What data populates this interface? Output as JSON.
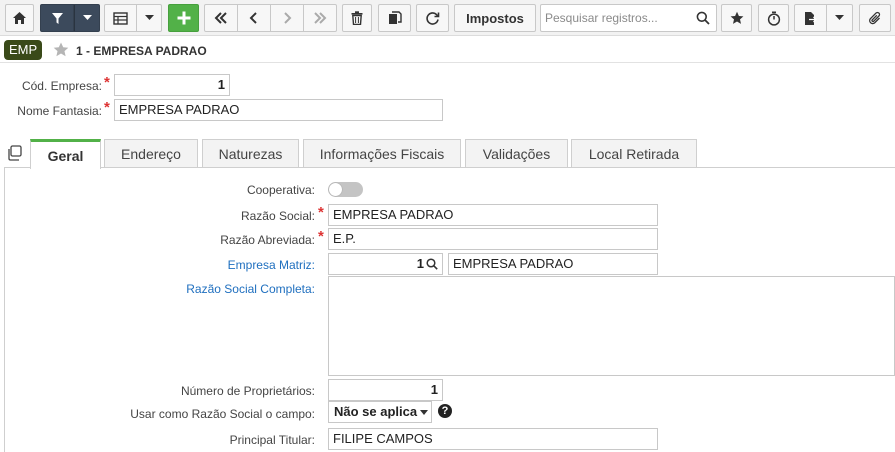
{
  "toolbar": {
    "impostos_label": "Impostos",
    "search_placeholder": "Pesquisar registros..."
  },
  "header": {
    "badge": "EMP",
    "record_title": "1 - EMPRESA PADRAO"
  },
  "top_form": {
    "cod_empresa_label": "Cód. Empresa:",
    "cod_empresa_value": "1",
    "nome_fantasia_label": "Nome Fantasia:",
    "nome_fantasia_value": "EMPRESA PADRAO"
  },
  "tabs": [
    {
      "label": "Geral"
    },
    {
      "label": "Endereço"
    },
    {
      "label": "Naturezas"
    },
    {
      "label": "Informações Fiscais"
    },
    {
      "label": "Validações"
    },
    {
      "label": "Local Retirada"
    }
  ],
  "geral": {
    "cooperativa_label": "Cooperativa:",
    "razao_social_label": "Razão Social:",
    "razao_social_value": "EMPRESA PADRAO",
    "razao_abreviada_label": "Razão Abreviada:",
    "razao_abreviada_value": "E.P.",
    "empresa_matriz_label": "Empresa Matriz:",
    "empresa_matriz_code": "1",
    "empresa_matriz_name": "EMPRESA PADRAO",
    "razao_social_completa_label": "Razão Social Completa:",
    "numero_proprietarios_label": "Número de Proprietários:",
    "numero_proprietarios_value": "1",
    "usar_como_label": "Usar como Razão Social o campo:",
    "usar_como_value": "Não se aplica",
    "principal_titular_label": "Principal Titular:",
    "principal_titular_value": "FILIPE CAMPOS"
  },
  "colors": {
    "accent_green": "#52b148",
    "toolbar_dark": "#3c4a5c",
    "badge_bg": "#3a4a19",
    "required_red": "#d33333",
    "link_blue": "#1f6fbf"
  }
}
